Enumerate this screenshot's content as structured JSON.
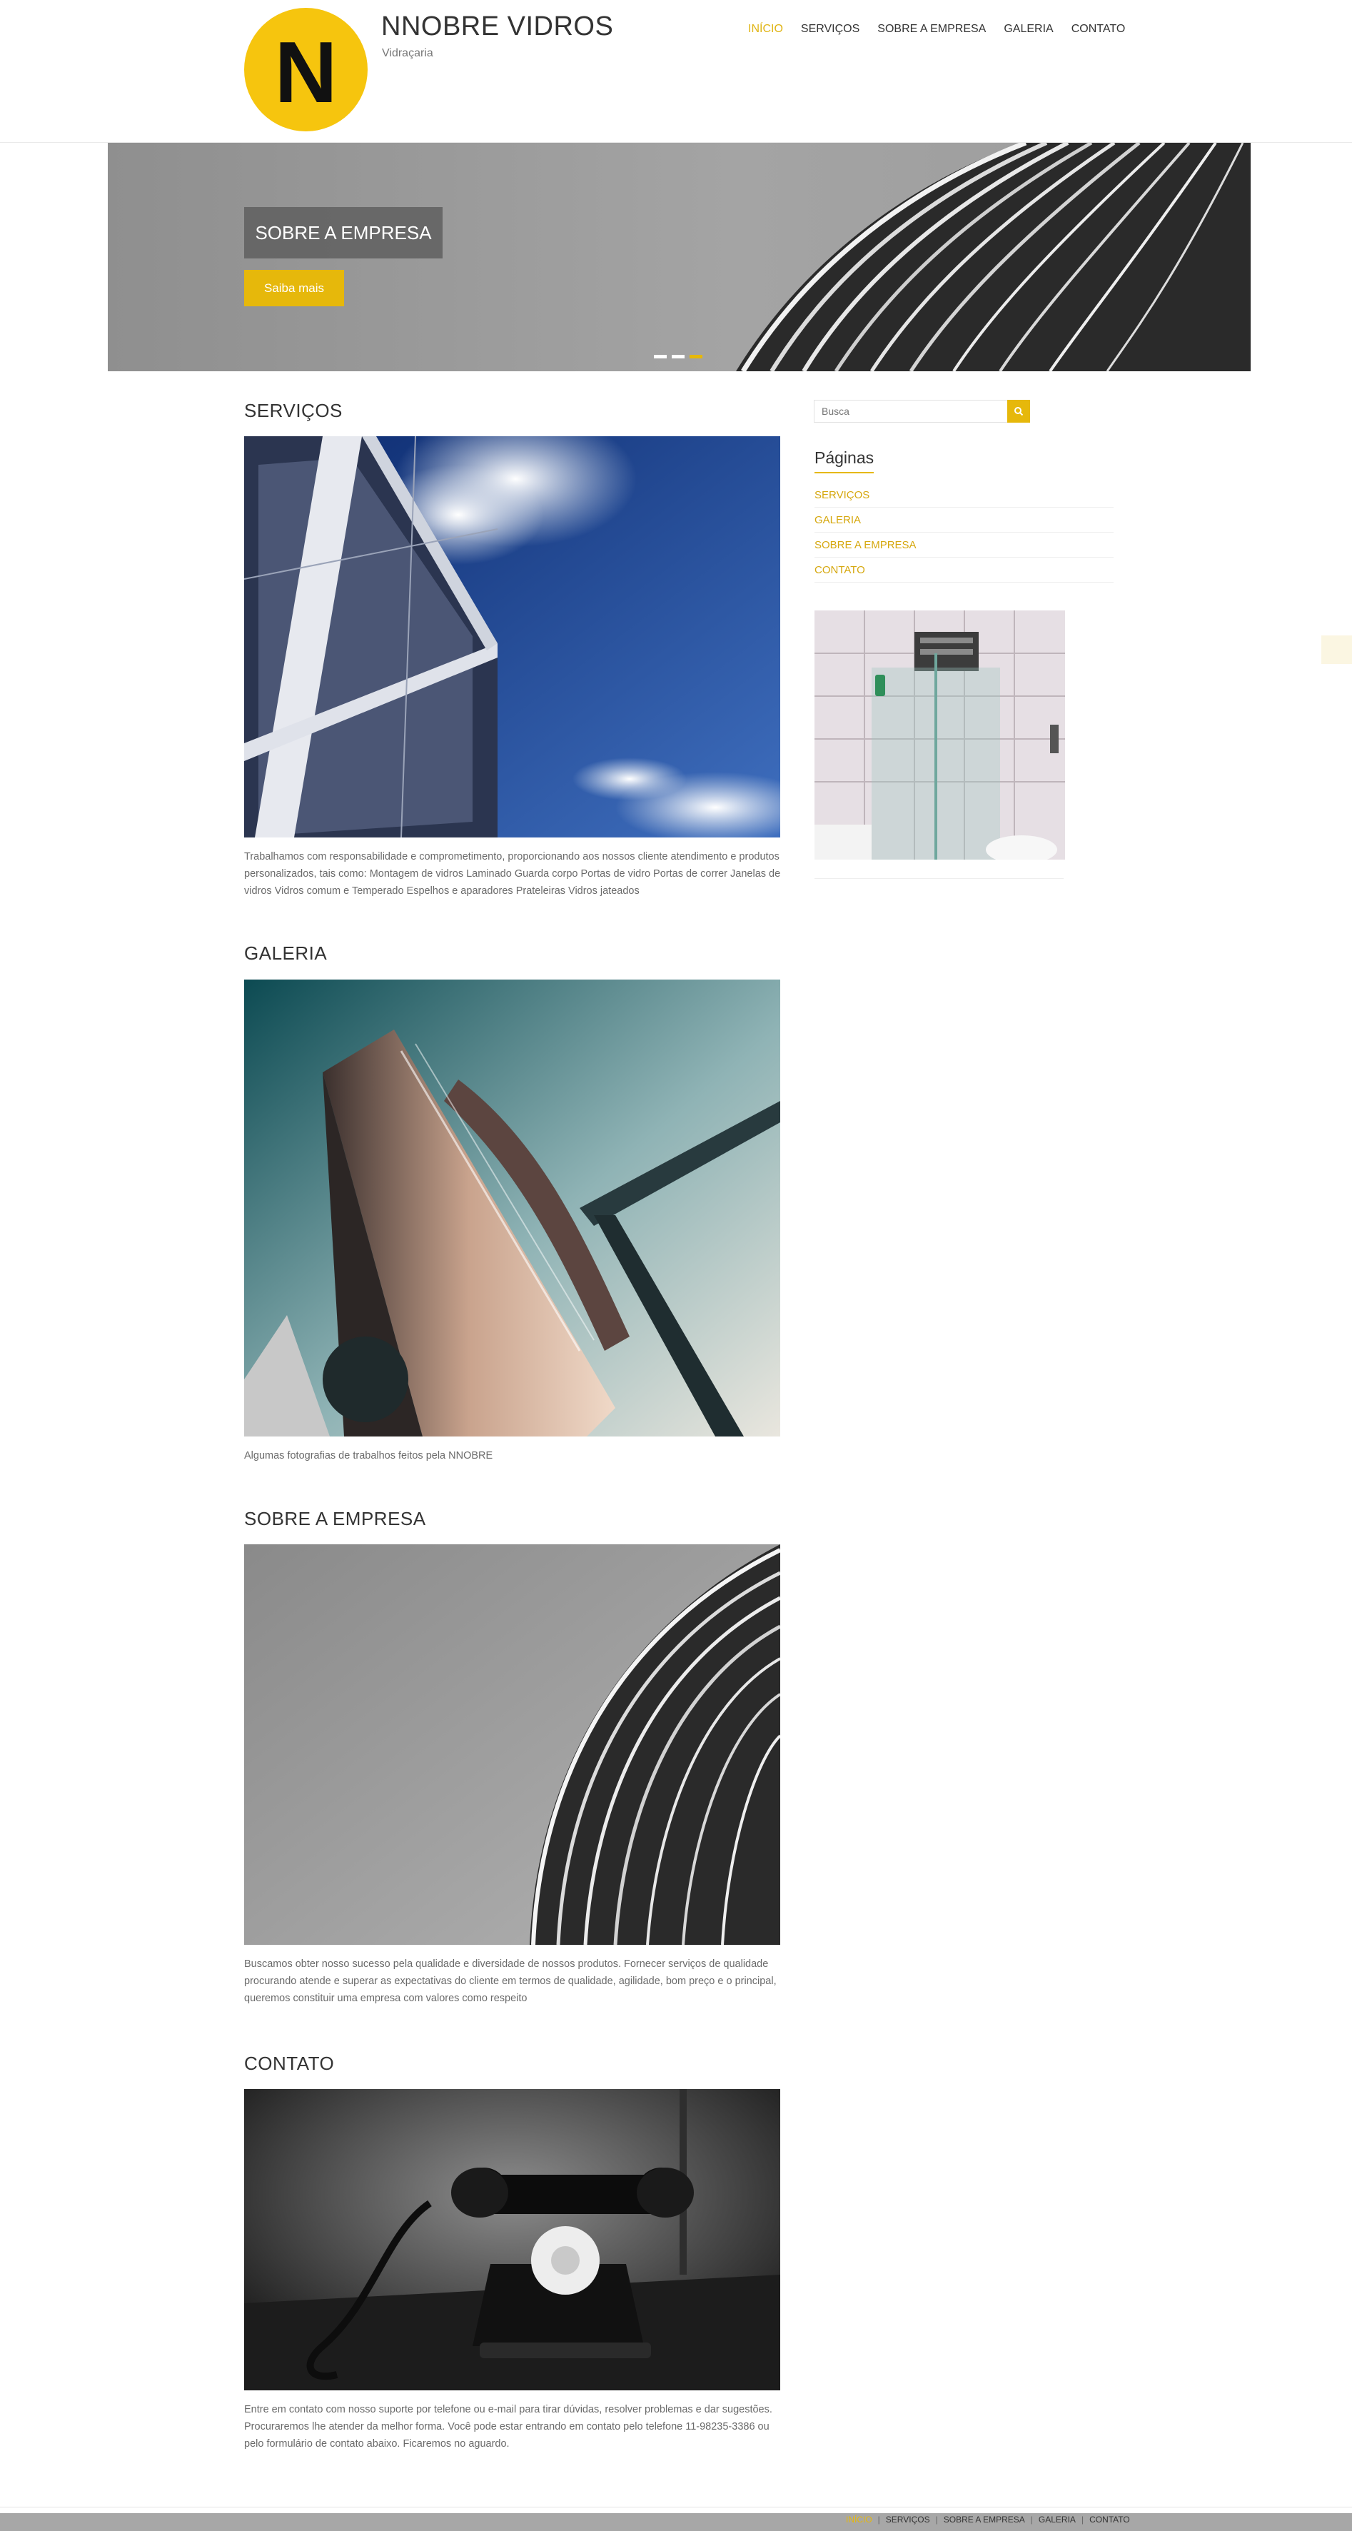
{
  "brand": {
    "logo_letter": "N",
    "title": "NNOBRE VIDROS",
    "tagline": "Vidraçaria",
    "accent_color": "#e6b80b"
  },
  "nav": {
    "items": [
      {
        "label": "INÍCIO",
        "active": true
      },
      {
        "label": "SERVIÇOS",
        "active": false
      },
      {
        "label": "SOBRE A EMPRESA",
        "active": false
      },
      {
        "label": "GALERIA",
        "active": false
      },
      {
        "label": "CONTATO",
        "active": false
      }
    ]
  },
  "slider": {
    "title": "SOBRE A EMPRESA",
    "button_label": "Saiba mais",
    "slide_count": 3,
    "active_slide": 3
  },
  "posts": [
    {
      "title": "SERVIÇOS",
      "image": "glass-building-blue-sky-image",
      "text": "Trabalhamos com responsabilidade e comprometimento, proporcionando aos nossos cliente atendimento e produtos personalizados, tais como: Montagem de vidros Laminado Guarda corpo Portas de vidro Portas de correr Janelas de vidros Vidros comum e Temperado Espelhos e aparadores Prateleiras Vidros jateados"
    },
    {
      "title": "GALERIA",
      "image": "modern-building-teal-sky-image",
      "text": "Algumas fotografias de trabalhos feitos pela NNOBRE"
    },
    {
      "title": "SOBRE A EMPRESA",
      "image": "curved-building-grayscale-image",
      "text": "Buscamos obter nosso sucesso pela qualidade e diversidade de nossos produtos. Fornecer serviços de qualidade procurando atende e superar as expectativas do cliente em termos de qualidade, agilidade, bom preço e o principal, queremos constituir uma empresa com valores como respeito"
    },
    {
      "title": "CONTATO",
      "image": "vintage-telephone-image",
      "text": "Entre em contato com nosso suporte por telefone ou e-mail para tirar dúvidas, resolver problemas e dar sugestões. Procuraremos lhe atender da melhor forma. Você pode estar entrando em contato pelo telefone 11-98235-3386 ou pelo formulário de contato abaixo. Ficaremos no aguardo."
    }
  ],
  "sidebar": {
    "search_placeholder": "Busca",
    "widget_title": "Páginas",
    "pages": [
      "SERVIÇOS",
      "GALERIA",
      "SOBRE A EMPRESA",
      "CONTATO"
    ],
    "image": "glass-shower-enclosure-image"
  },
  "footer": {
    "nav": [
      "INÍCIO",
      "SERVIÇOS",
      "SOBRE A EMPRESA",
      "GALERIA",
      "CONTATO"
    ]
  }
}
